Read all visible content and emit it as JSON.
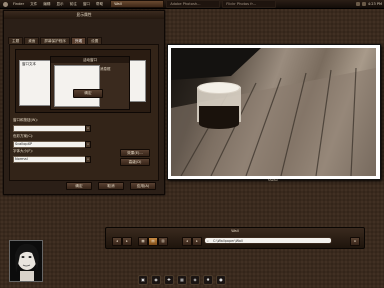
{
  "menubar": {
    "items": [
      "Finder",
      "文件",
      "编辑",
      "显示",
      "前往",
      "窗口",
      "帮助"
    ],
    "tasks": [
      {
        "label": "Wall",
        "active": true
      },
      {
        "label": "Adobe Photosh...",
        "active": false
      },
      {
        "label": "Flickr Photos fr...",
        "active": false
      }
    ],
    "tray_text": "4:23 PM"
  },
  "dialog": {
    "title": "显示属性",
    "tabs": [
      "主题",
      "桌面",
      "屏幕保护程序",
      "外观",
      "设置"
    ],
    "selected_tab": 3,
    "sub_dialog": {
      "title": "活动窗口",
      "left_text": "窗口文本",
      "mid_text": "消息框",
      "ok_label": "确定"
    },
    "labels": {
      "window_label": "窗口和按钮(W):",
      "color_label": "色彩方案(C):",
      "font_label": "字体大小(F):"
    },
    "fields": {
      "window_value": "",
      "color_value": "ScallopXP",
      "font_value": "Normal"
    },
    "side_buttons": [
      "效果(E)...",
      "高级(D)"
    ],
    "footer_buttons": [
      "确定",
      "取消",
      "应用(A)"
    ]
  },
  "photo": {
    "caption": "Shelter"
  },
  "wall": {
    "title": "Wall",
    "nav_buttons": [
      "◂",
      "▸",
      "▦",
      "▤",
      "▥"
    ],
    "view_buttons": [
      "◂",
      "▸"
    ],
    "search_placeholder": "C:\\Wallpaper\\Wall",
    "end_button": "⌂"
  },
  "dock": {
    "icons": [
      "▣",
      "◉",
      "✚",
      "▦",
      "◈",
      "✸",
      "●"
    ]
  }
}
